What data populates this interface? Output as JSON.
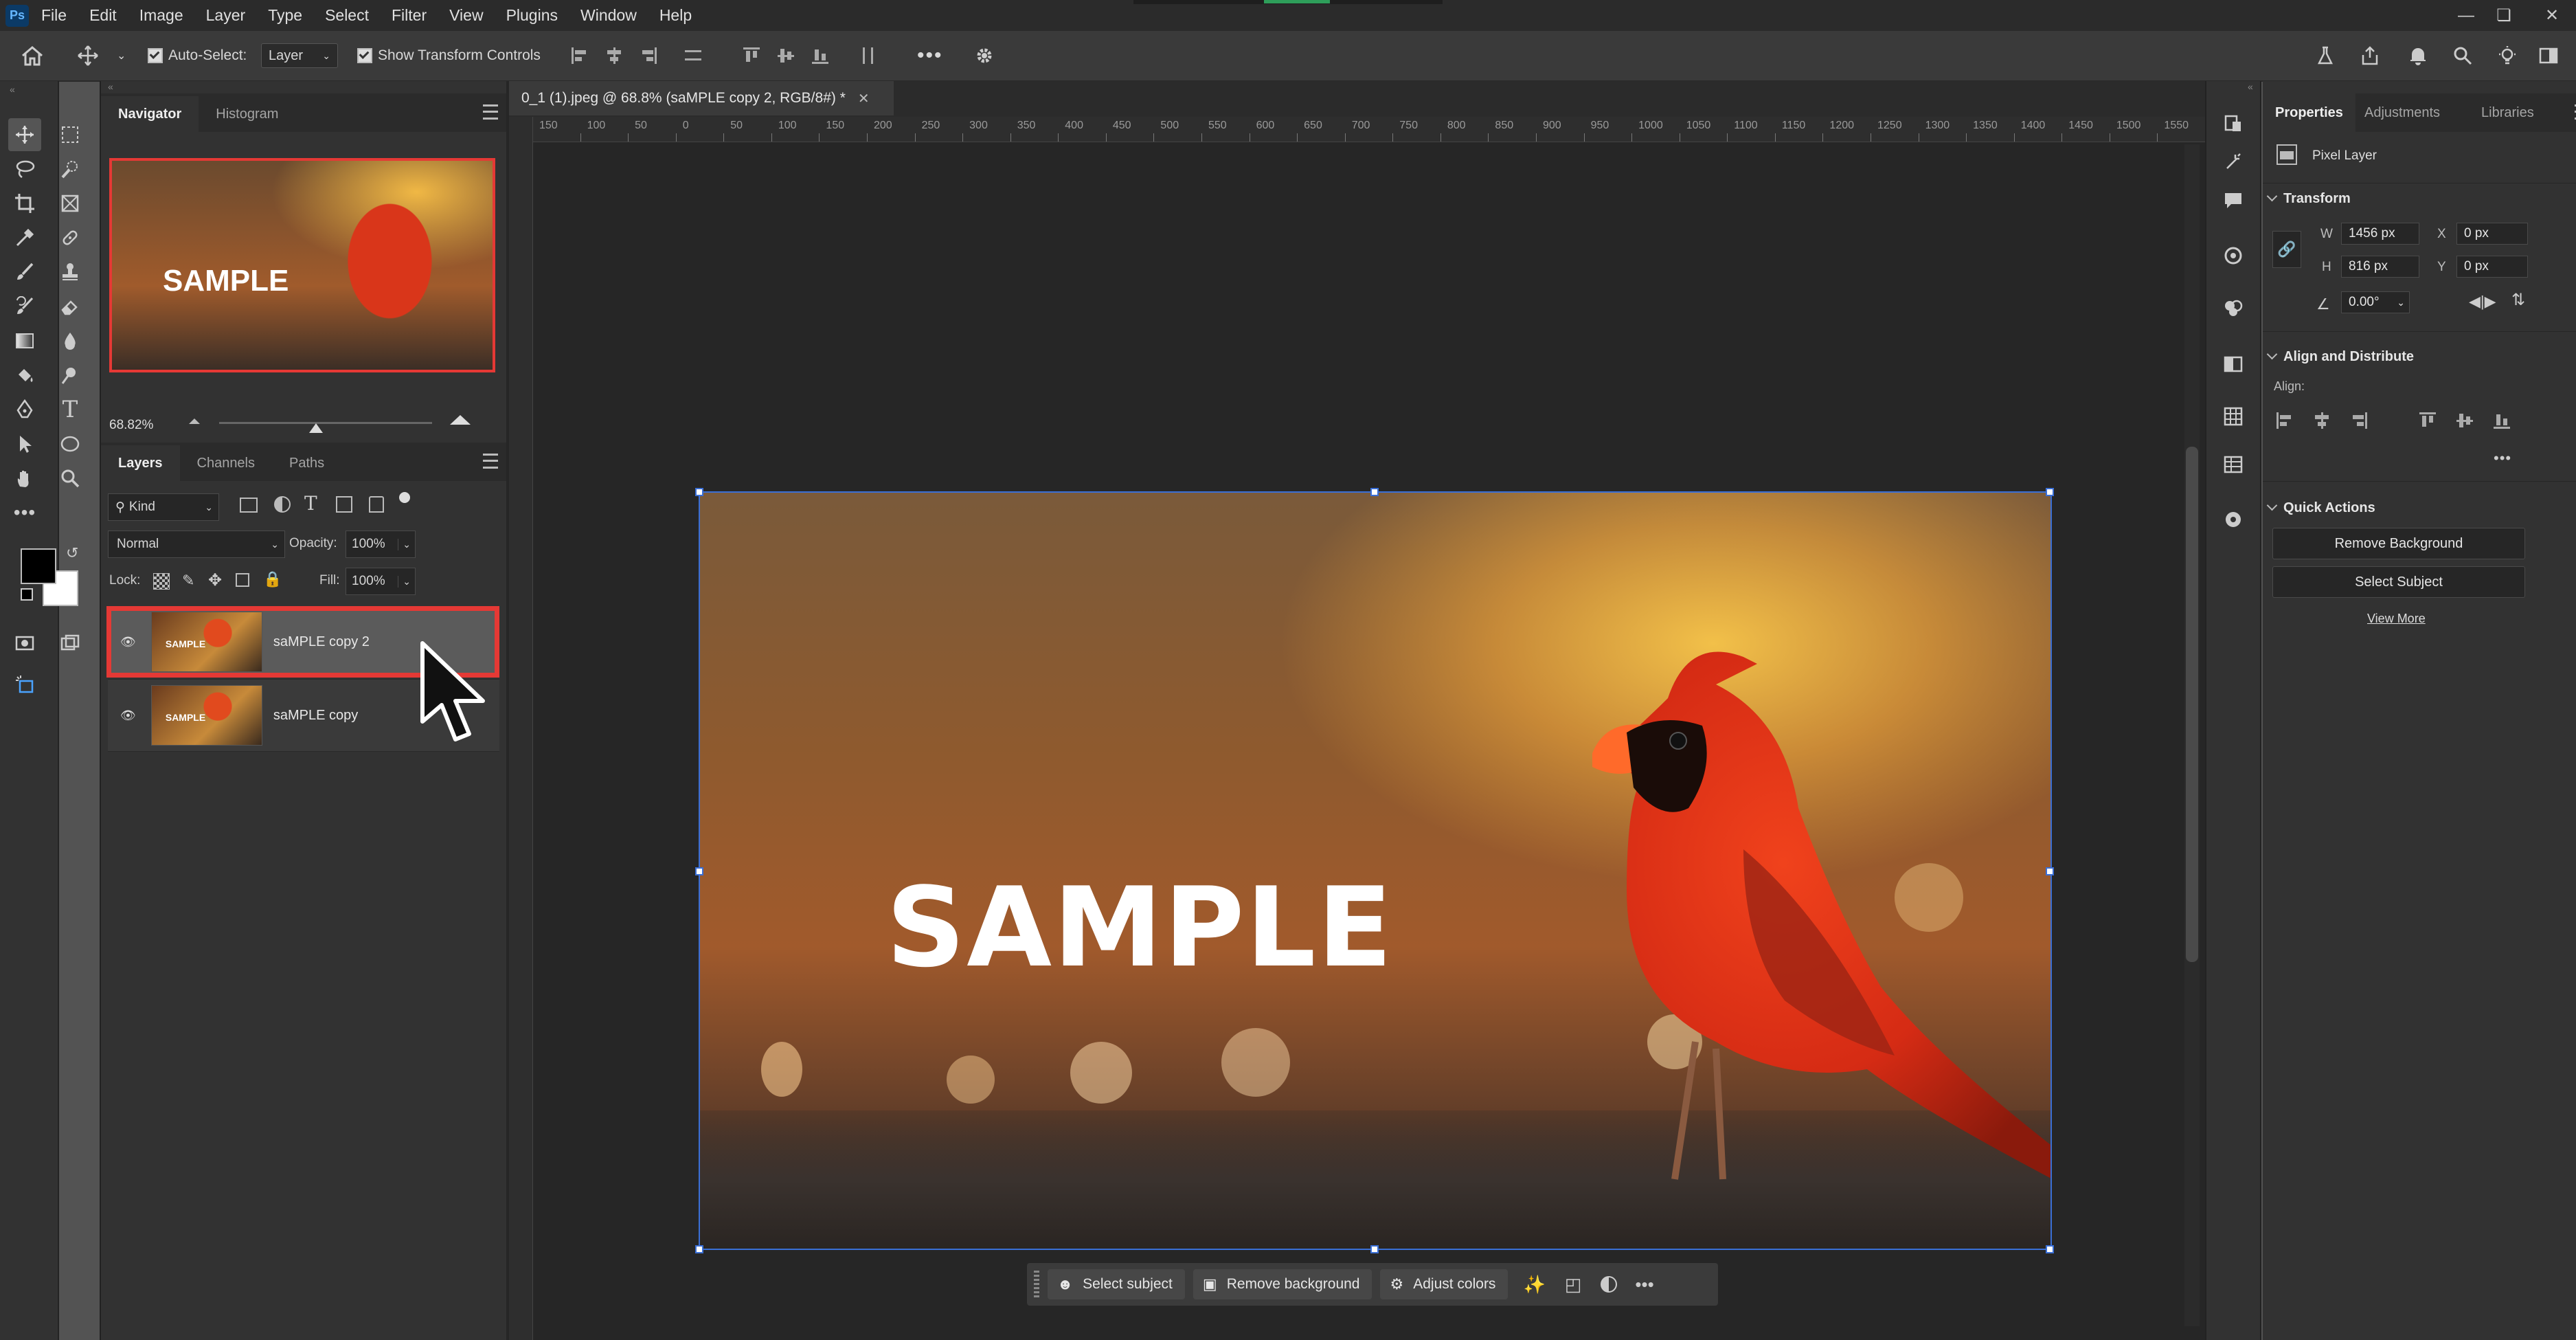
{
  "app": {
    "logo": "Ps",
    "menu": [
      "File",
      "Edit",
      "Image",
      "Layer",
      "Type",
      "Select",
      "Filter",
      "View",
      "Plugins",
      "Window",
      "Help"
    ]
  },
  "optionsbar": {
    "auto_select_label": "Auto-Select:",
    "auto_select_value": "Layer",
    "show_transform_label": "Show Transform Controls"
  },
  "navigator": {
    "tabs": [
      "Navigator",
      "Histogram"
    ],
    "zoom": "68.82%",
    "thumb_text": "SAMPLE"
  },
  "layers_panel": {
    "tabs": [
      "Layers",
      "Channels",
      "Paths"
    ],
    "filter_kind": "Kind",
    "blend_mode": "Normal",
    "opacity_label": "Opacity:",
    "opacity_value": "100%",
    "lock_label": "Lock:",
    "fill_label": "Fill:",
    "fill_value": "100%",
    "layers": [
      {
        "name": "saMPLE copy 2",
        "selected": true,
        "thumb_text": "SAMPLE"
      },
      {
        "name": "saMPLE copy",
        "selected": false,
        "thumb_text": "SAMPLE"
      }
    ]
  },
  "document": {
    "tab_title": "0_1 (1).jpeg @ 68.8% (saMPLE copy 2, RGB/8#) *",
    "watermark_text": "SAMPLE",
    "ruler_labels": [
      "150",
      "100",
      "50",
      "0",
      "50",
      "100",
      "150",
      "200",
      "250",
      "300",
      "350",
      "400",
      "450",
      "500",
      "550",
      "600",
      "650",
      "700",
      "750",
      "800",
      "850",
      "900",
      "950",
      "1000",
      "1050",
      "1100",
      "1150",
      "1200",
      "1250",
      "1300",
      "1350",
      "1400",
      "1450",
      "1500",
      "1550"
    ]
  },
  "context_bar": {
    "select_subject": "Select subject",
    "remove_background": "Remove background",
    "adjust_colors": "Adjust colors"
  },
  "properties": {
    "tabs": [
      "Properties",
      "Adjustments",
      "Libraries"
    ],
    "layer_type": "Pixel Layer",
    "transform_title": "Transform",
    "w_label": "W",
    "w_value": "1456 px",
    "h_label": "H",
    "h_value": "816 px",
    "x_label": "X",
    "x_value": "0 px",
    "y_label": "Y",
    "y_value": "0 px",
    "angle_value": "0.00°",
    "align_title": "Align and Distribute",
    "align_label": "Align:",
    "quick_title": "Quick Actions",
    "remove_bg_btn": "Remove Background",
    "select_subject_btn": "Select Subject",
    "view_more": "View More"
  },
  "colors": {
    "accent_highlight": "#e53935",
    "selection_blue": "#3a6fd6",
    "panel_bg": "#323232"
  }
}
